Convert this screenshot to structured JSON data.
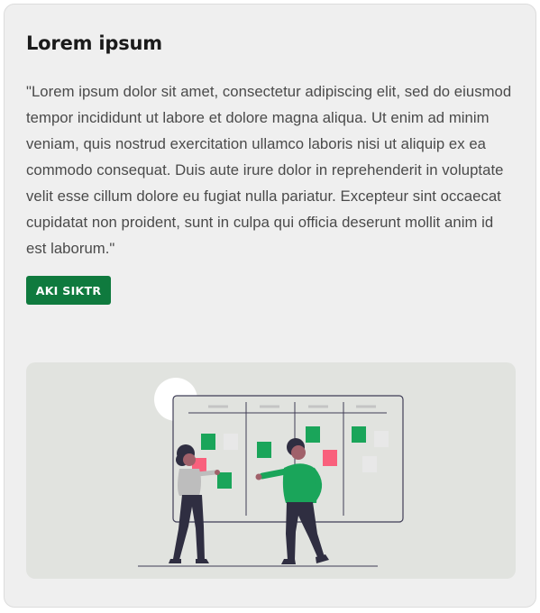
{
  "card": {
    "title": "Lorem ipsum",
    "body": "\"Lorem ipsum dolor sit amet, consectetur adipiscing elit, sed do eiusmod tempor incididunt ut labore et dolore magna aliqua. Ut enim ad minim veniam, quis nostrud exercitation ullamco laboris nisi ut aliquip ex ea commodo consequat. Duis aute irure dolor in reprehenderit in voluptate velit esse cillum dolore eu fugiat nulla pariatur. Excepteur sint occaecat cupidatat non proident, sunt in culpa qui officia deserunt mollit anim id est laborum.\"",
    "button_label": "AKI SIKTR"
  },
  "colors": {
    "card_background": "#efefef",
    "button": "#0f7a3e",
    "illustration_background": "#e1e3df",
    "sticky_green": "#1aa55a",
    "sticky_pink": "#f9607c",
    "sticky_grey": "#e8e8e8",
    "shirt_green": "#1aa55a",
    "dark_navy": "#2f2e41"
  },
  "illustration": {
    "subject": "team-planning-board"
  }
}
